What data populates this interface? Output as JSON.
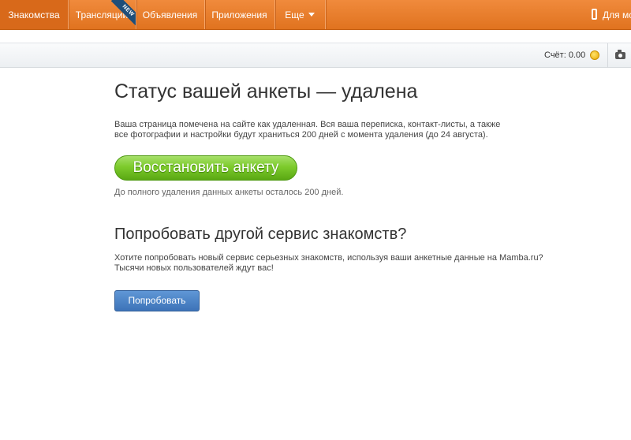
{
  "nav": {
    "items": [
      {
        "label": "Знакомства"
      },
      {
        "label": "Трансляции",
        "badge": "NEW"
      },
      {
        "label": "Объявления"
      },
      {
        "label": "Приложения"
      },
      {
        "label": "Еще"
      }
    ],
    "right_label": "Для мо"
  },
  "subbar": {
    "balance": "Счёт: 0.00"
  },
  "main": {
    "title": "Статус вашей анкеты — удалена",
    "description_line1": "Ваша страница помечена на сайте как удаленная. Вся ваша переписка, контакт-листы, а также",
    "description_line2": "все фотографии и настройки будут храниться 200 дней с момента удаления (до 24 августа).",
    "restore_button": "Восстановить анкету",
    "days_left": "До полного удаления данных анкеты осталось 200 дней.",
    "alt_title": "Попробовать другой сервис знакомств?",
    "alt_desc_line1": "Хотите попробовать новый сервис серьезных знакомств, используя ваши анкетные данные на Mamba.ru?",
    "alt_desc_line2": "Тысячи новых пользователей ждут вас!",
    "try_button": "Попробовать"
  },
  "colors": {
    "nav_orange": "#e0731f",
    "restore_green": "#7dcb2c",
    "try_blue": "#3d73b8"
  }
}
